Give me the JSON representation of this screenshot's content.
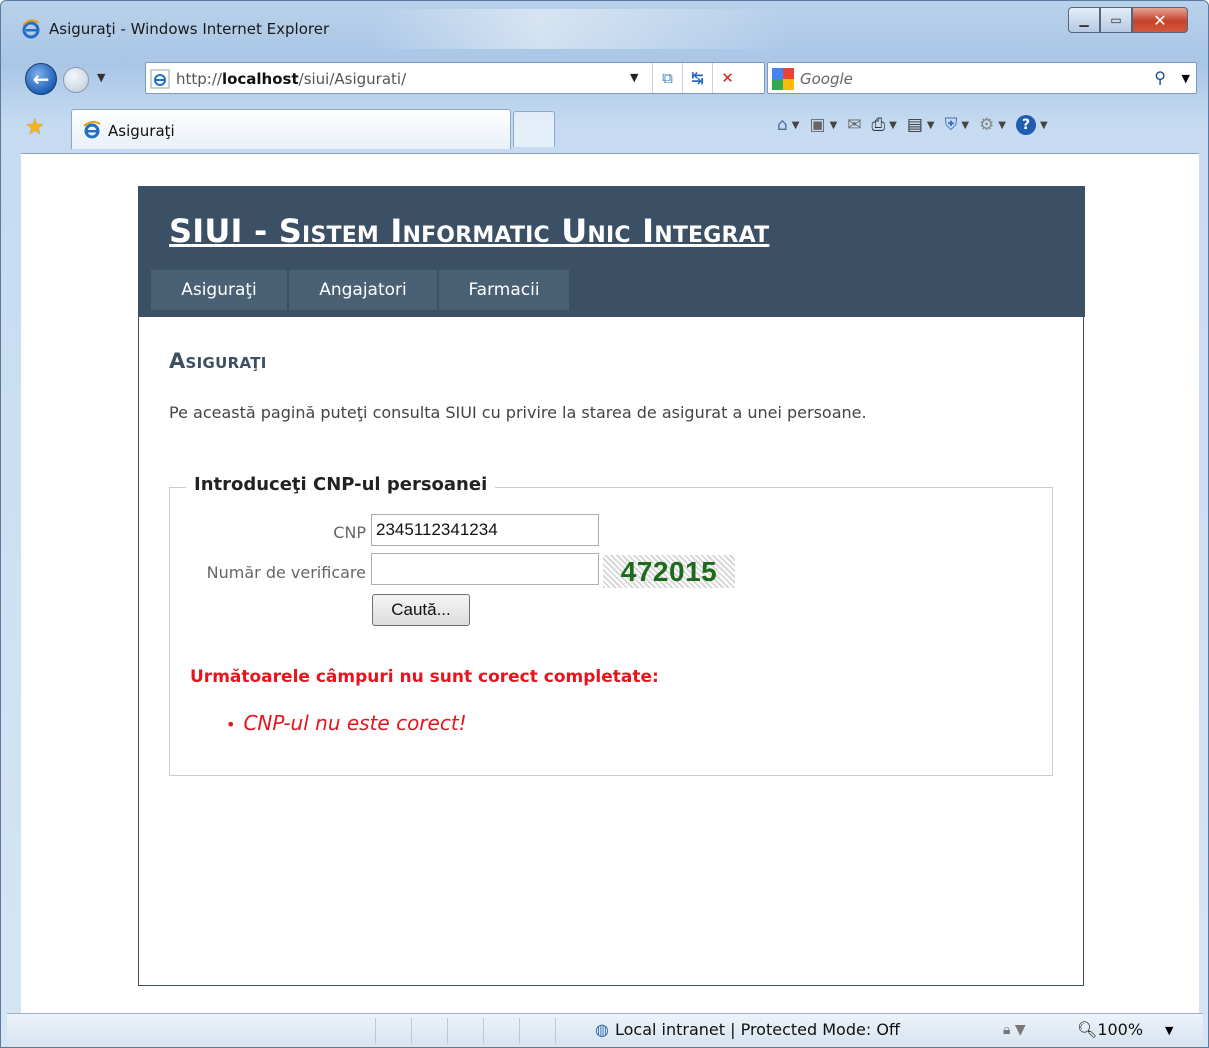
{
  "window": {
    "title": "Asiguraţi - Windows Internet Explorer"
  },
  "nav": {
    "address_prefix": "http://",
    "address_host": "localhost",
    "address_path": "/siui/Asigurati/",
    "search_placeholder": "Google"
  },
  "tab": {
    "label": "Asiguraţi"
  },
  "site": {
    "title": "SIUI - Sistem Informatic Unic Integrat",
    "menu": [
      {
        "label": "Asiguraţi"
      },
      {
        "label": "Angajatori"
      },
      {
        "label": "Farmacii"
      }
    ]
  },
  "page": {
    "title": "Asiguraţi",
    "intro": "Pe această pagină puteţi consulta SIUI cu privire la starea de asigurat a unei persoane.",
    "form": {
      "legend": "Introduceţi CNP-ul persoanei",
      "cnp_label": "CNP",
      "cnp_value": "2345112341234",
      "verify_label": "Număr de verificare",
      "verify_value": "",
      "captcha_code": "472015",
      "submit_label": "Caută..."
    },
    "errors": {
      "title": "Următoarele câmpuri nu sunt corect completate:",
      "items": [
        "CNP-ul nu este corect!"
      ]
    }
  },
  "status": {
    "zone": "Local intranet | Protected Mode: Off",
    "zoom": "100%"
  },
  "colors": {
    "header_bg": "#3b5064",
    "nav_item_bg": "#4a6075",
    "error": "#e8141d",
    "captcha_text": "#1c6a1c"
  }
}
